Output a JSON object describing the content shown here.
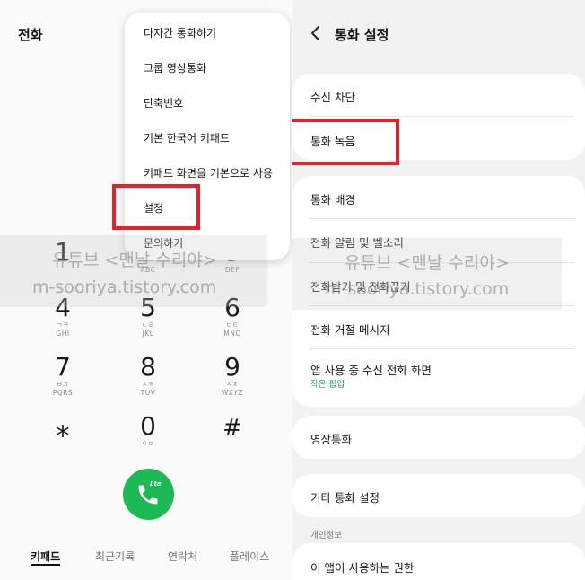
{
  "dialer": {
    "title": "전화",
    "menu_items": [
      "다자간 통화하기",
      "그룹 영상통화",
      "단축번호",
      "기본 한국어 키패드",
      "키패드 화면을 기본으로 사용",
      "설정",
      "문의하기"
    ],
    "keys": [
      {
        "digit": "1",
        "sub": ""
      },
      {
        "digit": "2",
        "sub": "ABC"
      },
      {
        "digit": "3",
        "sub": "DEF"
      },
      {
        "digit": "4",
        "ko": "ㄱㅋ",
        "sub": "GHI"
      },
      {
        "digit": "5",
        "ko": "ㄴㄹ",
        "sub": "JKL"
      },
      {
        "digit": "6",
        "ko": "ㄷㅌ",
        "sub": "MNO"
      },
      {
        "digit": "7",
        "ko": "ㅂㅍ",
        "sub": "PQRS"
      },
      {
        "digit": "8",
        "ko": "ㅅㅎ",
        "sub": "TUV"
      },
      {
        "digit": "9",
        "ko": "ㅈㅊ",
        "sub": "WXYZ"
      },
      {
        "digit": "⁎",
        "sub": ""
      },
      {
        "digit": "0",
        "ko": "ㅇㅁ",
        "sub": ""
      },
      {
        "digit": "#",
        "sub": ""
      }
    ],
    "call_badge": "Lte",
    "tabs": [
      "키패드",
      "최근기록",
      "연락처",
      "플레이스"
    ],
    "active_tab": "키패드"
  },
  "settings": {
    "title": "통화 설정",
    "rows": {
      "block": "수신 차단",
      "record": "통화 녹음",
      "background": "통화 배경",
      "ringtone": "전화 알림 및 벨소리",
      "answer_end": "전화받기 및 전화끊기",
      "decline_msg": "전화 거절 메시지",
      "in_app": "앱 사용 중 수신 전화 화면",
      "in_app_sub": "작은 팝업",
      "video": "영상통화",
      "other": "기타 통화 설정",
      "privacy_section": "개인정보",
      "permissions": "이 앱이 사용하는 권한"
    }
  },
  "watermark": {
    "line1": "유튜브 <맨날 수리야>",
    "line2": "m-sooriya.tistory.com"
  },
  "colors": {
    "call_green": "#1db954",
    "highlight_red": "#e8202a",
    "sub_text_green": "#1e9b7a"
  }
}
